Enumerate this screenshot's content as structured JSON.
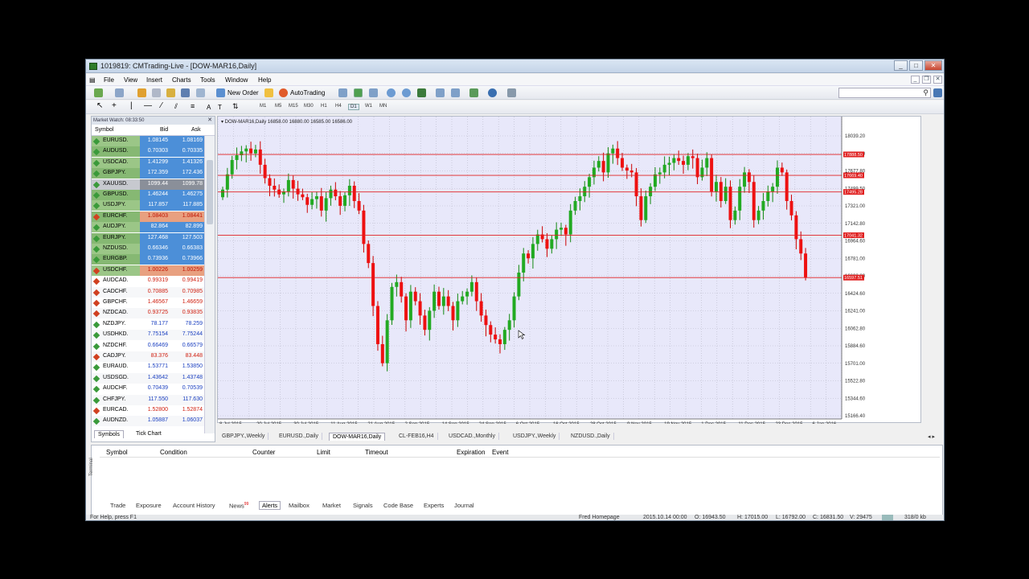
{
  "window": {
    "title": "1019819: CMTrading-Live - [DOW-MAR16,Daily]"
  },
  "menu": [
    "File",
    "View",
    "Insert",
    "Charts",
    "Tools",
    "Window",
    "Help"
  ],
  "toolbar": {
    "new_order": "New Order",
    "autotrading": "AutoTrading",
    "timeframes": [
      "M1",
      "M5",
      "M15",
      "M30",
      "H1",
      "H4",
      "D1",
      "W1",
      "MN"
    ],
    "active_timeframe": "D1"
  },
  "market_watch": {
    "title": "Market Watch: 08:33:50",
    "headers": {
      "symbol": "Symbol",
      "bid": "Bid",
      "ask": "Ask"
    },
    "rows": [
      {
        "symbol": "EURUSD.",
        "bid": "1.08145",
        "ask": "1.08169",
        "color": "#3a9a3a"
      },
      {
        "symbol": "AUDUSD.",
        "bid": "0.70303",
        "ask": "0.70335",
        "color": "#3a9a3a"
      },
      {
        "symbol": "USDCAD.",
        "bid": "1.41299",
        "ask": "1.41326",
        "color": "#3a9a3a"
      },
      {
        "symbol": "GBPJPY.",
        "bid": "172.359",
        "ask": "172.436",
        "color": "#3a9a3a"
      },
      {
        "symbol": "XAUUSD.",
        "bid": "1099.44",
        "ask": "1099.78",
        "color": "#3a9a3a"
      },
      {
        "symbol": "GBPUSD.",
        "bid": "1.46244",
        "ask": "1.46275",
        "color": "#3a9a3a"
      },
      {
        "symbol": "USDJPY.",
        "bid": "117.857",
        "ask": "117.885",
        "color": "#3a9a3a"
      },
      {
        "symbol": "EURCHF.",
        "bid": "1.08403",
        "ask": "1.08441",
        "color": "#d04020"
      },
      {
        "symbol": "AUDJPY.",
        "bid": "82.864",
        "ask": "82.899",
        "color": "#3a9a3a"
      },
      {
        "symbol": "EURJPY.",
        "bid": "127.468",
        "ask": "127.503",
        "color": "#3a9a3a"
      },
      {
        "symbol": "NZDUSD.",
        "bid": "0.66346",
        "ask": "0.66383",
        "color": "#3a9a3a"
      },
      {
        "symbol": "EURGBP.",
        "bid": "0.73936",
        "ask": "0.73966",
        "color": "#3a9a3a"
      },
      {
        "symbol": "USDCHF.",
        "bid": "1.00226",
        "ask": "1.00259",
        "color": "#d04020"
      },
      {
        "symbol": "AUDCAD.",
        "bid": "0.99319",
        "ask": "0.99419",
        "color": "#d04020"
      },
      {
        "symbol": "CADCHF.",
        "bid": "0.70885",
        "ask": "0.70985",
        "color": "#d04020"
      },
      {
        "symbol": "GBPCHF.",
        "bid": "1.46567",
        "ask": "1.46659",
        "color": "#d04020"
      },
      {
        "symbol": "NZDCAD.",
        "bid": "0.93725",
        "ask": "0.93835",
        "color": "#d04020"
      },
      {
        "symbol": "NZDJPY.",
        "bid": "78.177",
        "ask": "78.259",
        "color": "#3a9a3a"
      },
      {
        "symbol": "USDHKD.",
        "bid": "7.75154",
        "ask": "7.75244",
        "color": "#3a9a3a"
      },
      {
        "symbol": "NZDCHF.",
        "bid": "0.66469",
        "ask": "0.66579",
        "color": "#3a9a3a"
      },
      {
        "symbol": "CADJPY.",
        "bid": "83.376",
        "ask": "83.448",
        "color": "#d04020"
      },
      {
        "symbol": "EURAUD.",
        "bid": "1.53771",
        "ask": "1.53850",
        "color": "#3a9a3a"
      },
      {
        "symbol": "USDSGD.",
        "bid": "1.43642",
        "ask": "1.43748",
        "color": "#3a9a3a"
      },
      {
        "symbol": "AUDCHF.",
        "bid": "0.70439",
        "ask": "0.70539",
        "color": "#3a9a3a"
      },
      {
        "symbol": "CHFJPY.",
        "bid": "117.550",
        "ask": "117.630",
        "color": "#3a9a3a"
      },
      {
        "symbol": "EURCAD.",
        "bid": "1.52800",
        "ask": "1.52874",
        "color": "#d04020"
      },
      {
        "symbol": "AUDNZD.",
        "bid": "1.05887",
        "ask": "1.06037",
        "color": "#3a9a3a"
      }
    ],
    "tabs": [
      "Symbols",
      "Tick Chart"
    ]
  },
  "chart": {
    "header": "DOW-MAR16,Daily  16858.00 16880.00 16585.00 16586.00",
    "y_ticks": [
      "18039.20",
      "17858.90",
      "17677.80",
      "17499.50",
      "17321.00",
      "17142.80",
      "16964.60",
      "16781.00",
      "16602.80",
      "16424.60",
      "16241.00",
      "16062.80",
      "15884.60",
      "15701.00",
      "15522.80",
      "15344.60",
      "15166.40"
    ],
    "h_lines": [
      {
        "label": "17888.50",
        "value": 17888.5
      },
      {
        "label": "17669.40",
        "value": 17669.4
      },
      {
        "label": "17495.28",
        "value": 17495.28
      },
      {
        "label": "17041.32",
        "value": 17041.32
      },
      {
        "label": "16597.51",
        "value": 16597.51
      }
    ],
    "x_labels": [
      "8 Jul 2015",
      "20 Jul 2015",
      "30 Jul 2015",
      "11 Aug 2015",
      "21 Aug 2015",
      "2 Sep 2015",
      "14 Sep 2015",
      "24 Sep 2015",
      "6 Oct 2015",
      "16 Oct 2015",
      "28 Oct 2015",
      "9 Nov 2015",
      "19 Nov 2015",
      "1 Dec 2015",
      "11 Dec 2015",
      "23 Dec 2015",
      "6 Jan 2016"
    ],
    "bull_color": "#22aa22",
    "bear_color": "#ee1111",
    "bg_color": "#e8e8fa"
  },
  "chart_data": {
    "type": "candlestick",
    "ylim": [
      15166.4,
      18217.4
    ],
    "closes": [
      17520,
      17680,
      17830,
      17880,
      17920,
      17950,
      17900,
      17940,
      17780,
      17640,
      17560,
      17520,
      17470,
      17500,
      17620,
      17530,
      17470,
      17440,
      17360,
      17420,
      17450,
      17300,
      17430,
      17520,
      17450,
      17350,
      17460,
      17560,
      17400,
      17300,
      16950,
      16750,
      16300,
      15900,
      15700,
      16150,
      16500,
      16550,
      16400,
      16150,
      16450,
      16350,
      16200,
      16050,
      16250,
      16450,
      16300,
      16400,
      16300,
      16150,
      16350,
      16400,
      16450,
      16550,
      16350,
      16200,
      16100,
      16000,
      15950,
      15900,
      16050,
      16150,
      16400,
      16650,
      16850,
      16800,
      16950,
      17050,
      17000,
      16900,
      17000,
      17100,
      17120,
      17050,
      17300,
      17400,
      17450,
      17550,
      17650,
      17750,
      17820,
      17700,
      17900,
      17950,
      17850,
      17750,
      17720,
      17700,
      17450,
      17200,
      17450,
      17550,
      17680,
      17700,
      17780,
      17800,
      17850,
      17820,
      17780,
      17870,
      17850,
      17650,
      17750,
      17850,
      17500,
      17600,
      17400,
      17550,
      17200,
      17300,
      17550,
      17700,
      17600,
      17200,
      17300,
      17400,
      17500,
      17550,
      17750,
      17700,
      17400,
      17250,
      17000,
      16850,
      16600
    ]
  }
}
